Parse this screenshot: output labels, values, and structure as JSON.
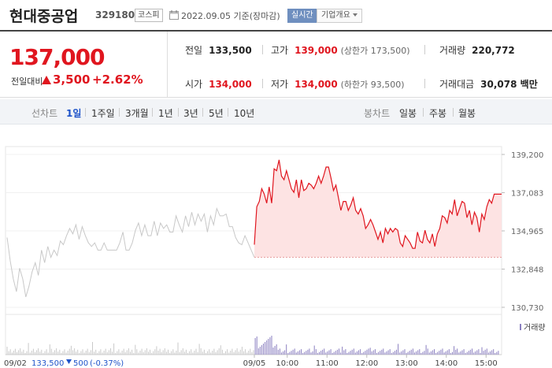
{
  "header": {
    "name": "현대중공업",
    "code": "329180",
    "market": "코스피",
    "basis": "2022.09.05 기준(장마감)",
    "realtime_label": "실시간",
    "company_label": "기업개요"
  },
  "summary": {
    "price": "137,000",
    "diff_label": "전일대비",
    "diff_value": "3,500",
    "diff_rate": "+2.62%",
    "stats": {
      "prev_label": "전일",
      "prev": "133,500",
      "high_label": "고가",
      "high": "139,000",
      "upper_limit": "(상한가 173,500)",
      "volume_label": "거래량",
      "volume": "220,772",
      "open_label": "시가",
      "open": "134,000",
      "low_label": "저가",
      "low": "134,000",
      "lower_limit": "(하한가 93,500)",
      "amount_label": "거래대금",
      "amount": "30,078 백만"
    }
  },
  "toolbar": {
    "line_label": "선차트",
    "line_periods": [
      "1일",
      "1주일",
      "3개월",
      "1년",
      "3년",
      "5년",
      "10년"
    ],
    "active_period": "1일",
    "candle_label": "봉차트",
    "candle_periods": [
      "일봉",
      "주봉",
      "월봉"
    ]
  },
  "colors": {
    "up": "#e0161f",
    "down": "#1e53c9",
    "prev_day_line": "#c8c8c8",
    "volume_bar": "#8a7fc0"
  },
  "chart_data": {
    "type": "line",
    "y_ticks": [
      "139,200",
      "137,083",
      "134,965",
      "132,848",
      "130,730"
    ],
    "ylim": [
      130730,
      139200
    ],
    "x_ticks": [
      "09/05",
      "10:00",
      "11:00",
      "12:00",
      "13:00",
      "14:00",
      "15:00"
    ],
    "volume_label": "거래량",
    "prev_day_footer": {
      "date": "09/02",
      "price": "133,500",
      "change": "500",
      "rate": "(-0.37%)"
    },
    "prev_close": 133500,
    "series": [
      {
        "key": "prev_day",
        "values": [
          134600,
          133300,
          132300,
          131600,
          132900,
          132300,
          131300,
          131900,
          132700,
          133200,
          132500,
          133900,
          133200,
          134100,
          133500,
          133900,
          133600,
          134400,
          134200,
          134700,
          135100,
          134800,
          135300,
          134500,
          135200,
          134700,
          134300,
          134100,
          134300,
          133900,
          133900,
          134300,
          133900,
          133900,
          133900,
          133900,
          134300,
          134900,
          133900,
          133900,
          134300,
          135000,
          135400,
          134700,
          135300,
          134700,
          134700,
          135500,
          134700,
          135400,
          135100,
          135300,
          134900,
          134900,
          135800,
          135300,
          134900,
          135800,
          135200,
          136000,
          135300,
          135900,
          135500,
          135900,
          134900,
          135800,
          135300,
          136200,
          135800,
          135800,
          135900,
          135200,
          135200,
          134600,
          134300,
          134200,
          134700,
          134300,
          133900,
          133500
        ]
      },
      {
        "key": "today",
        "values": [
          134200,
          136300,
          136600,
          137300,
          137000,
          136500,
          137400,
          136500,
          138400,
          138300,
          138900,
          138000,
          137800,
          138300,
          137800,
          137300,
          137100,
          137800,
          136800,
          137800,
          137200,
          137300,
          137600,
          137500,
          137300,
          137600,
          138000,
          137600,
          138000,
          138500,
          138500,
          137900,
          137200,
          137500,
          136800,
          136100,
          136600,
          136600,
          136100,
          136400,
          136800,
          136100,
          135900,
          136200,
          135800,
          135100,
          135300,
          135600,
          135300,
          134900,
          134500,
          134900,
          134300,
          135100,
          134800,
          135100,
          134900,
          135100,
          135000,
          134300,
          134100,
          134700,
          134500,
          134300,
          134000,
          134000,
          134900,
          134400,
          134300,
          135000,
          134500,
          134300,
          134800,
          134100,
          134800,
          135100,
          135800,
          135700,
          135400,
          136100,
          135900,
          136700,
          135800,
          136200,
          136600,
          136500,
          135700,
          136100,
          135300,
          136000,
          135700,
          134900,
          135900,
          135600,
          136300,
          136700,
          136500,
          137000,
          137000,
          137000,
          137000
        ]
      }
    ]
  }
}
